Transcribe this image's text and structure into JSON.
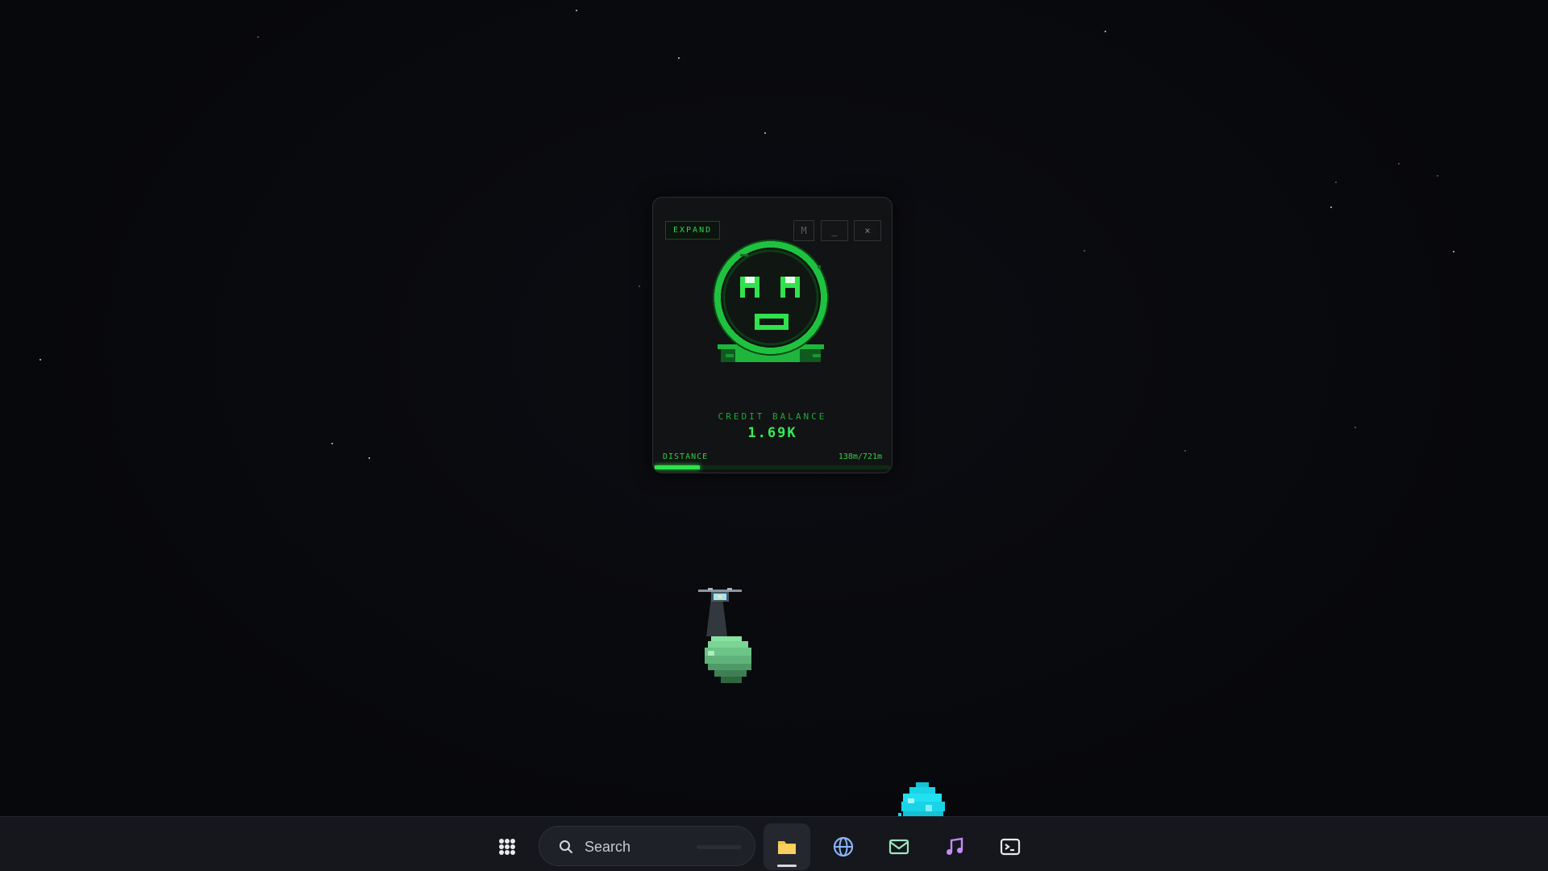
{
  "widget": {
    "expand_label": "EXPAND",
    "m_label": "M",
    "minimize_label": "_",
    "close_label": "×",
    "credit_label": "CREDIT BALANCE",
    "credit_value": "1.69K",
    "distance_label": "DISTANCE",
    "distance_value": "138m/721m",
    "distance_fraction": 0.191
  },
  "taskbar": {
    "search_placeholder": "Search"
  },
  "colors": {
    "accent_green": "#2ee34c",
    "crystal_cyan": "#19d3e6",
    "taskbar_bg": "#15171c",
    "folder_yellow": "#f4c542",
    "globe_blue": "#8ab4f8",
    "mail_green": "#9ee6c0",
    "music_purple": "#c58af9"
  },
  "icons": {
    "apps": "grid-icon",
    "search": "search-icon",
    "files": "folder-icon",
    "browser": "globe-icon",
    "mail": "mail-icon",
    "music": "music-note-icon",
    "terminal": "terminal-icon"
  }
}
